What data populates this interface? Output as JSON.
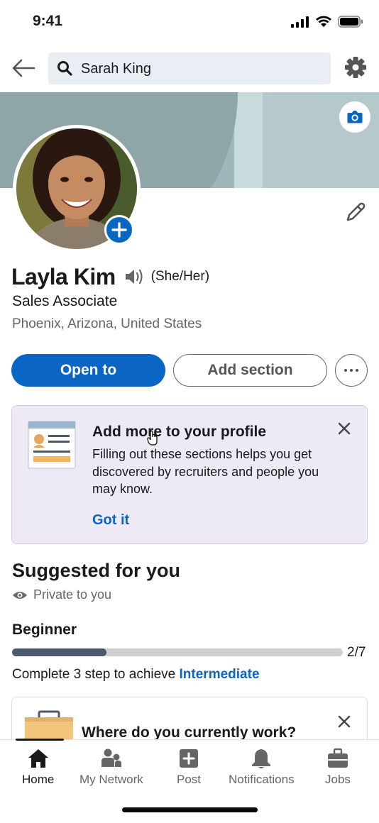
{
  "status_bar": {
    "time": "9:41"
  },
  "search": {
    "query": "Sarah King"
  },
  "profile": {
    "name": "Layla Kim",
    "pronouns": "(She/Her)",
    "headline": "Sales Associate",
    "location": "Phoenix, Arizona, United States"
  },
  "actions": {
    "open_to": "Open to",
    "add_section": "Add section"
  },
  "tip_card": {
    "title": "Add more to your profile",
    "body": "Filling out these sections helps you get discovered by recruiters and people you may know.",
    "link": "Got it"
  },
  "suggested": {
    "title": "Suggested for you",
    "privacy": "Private to you",
    "level": "Beginner",
    "progress_count": "2/7",
    "progress_fraction": 0.2857,
    "complete_prefix": "Complete 3 step to achieve ",
    "complete_link": "Intermediate",
    "work_question": "Where do you currently work?"
  },
  "nav": {
    "items": [
      {
        "label": "Home",
        "icon": "home-icon",
        "active": true
      },
      {
        "label": "My Network",
        "icon": "network-icon"
      },
      {
        "label": "Post",
        "icon": "post-icon"
      },
      {
        "label": "Notifications",
        "icon": "bell-icon"
      },
      {
        "label": "Jobs",
        "icon": "briefcase-icon"
      }
    ]
  },
  "colors": {
    "accent": "#0a66c2",
    "card_bg": "#eeeaf5",
    "banner": "#a1b6bb"
  }
}
